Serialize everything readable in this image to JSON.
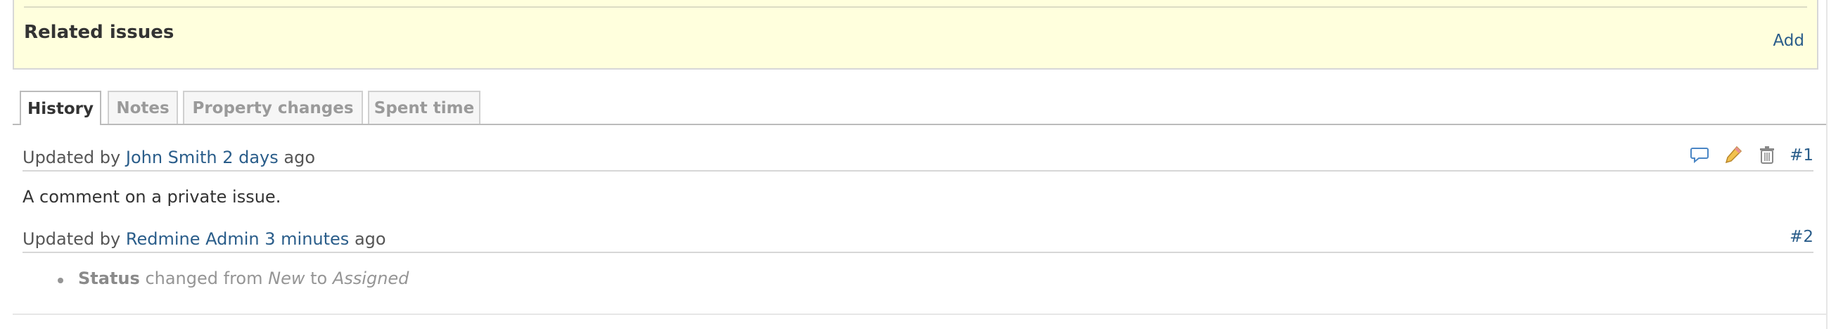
{
  "related": {
    "title": "Related issues",
    "add_label": "Add"
  },
  "tabs": [
    {
      "label": "History",
      "active": true
    },
    {
      "label": "Notes",
      "active": false
    },
    {
      "label": "Property changes",
      "active": false
    },
    {
      "label": "Spent time",
      "active": false
    }
  ],
  "journals": [
    {
      "prefix": "Updated by",
      "author": "John Smith",
      "age": "2 days",
      "suffix": "ago",
      "number": "#1",
      "actions": [
        "quote-icon",
        "edit-icon",
        "delete-icon"
      ],
      "comment": "A comment on a private issue."
    },
    {
      "prefix": "Updated by",
      "author": "Redmine Admin",
      "age": "3 minutes",
      "suffix": "ago",
      "number": "#2",
      "change": {
        "field": "Status",
        "changed_from": "changed from",
        "old_value": "New",
        "to": "to",
        "new_value": "Assigned"
      }
    }
  ],
  "colors": {
    "related_bg": "#ffffdd",
    "link": "#2a5d8a",
    "muted": "#959595"
  }
}
